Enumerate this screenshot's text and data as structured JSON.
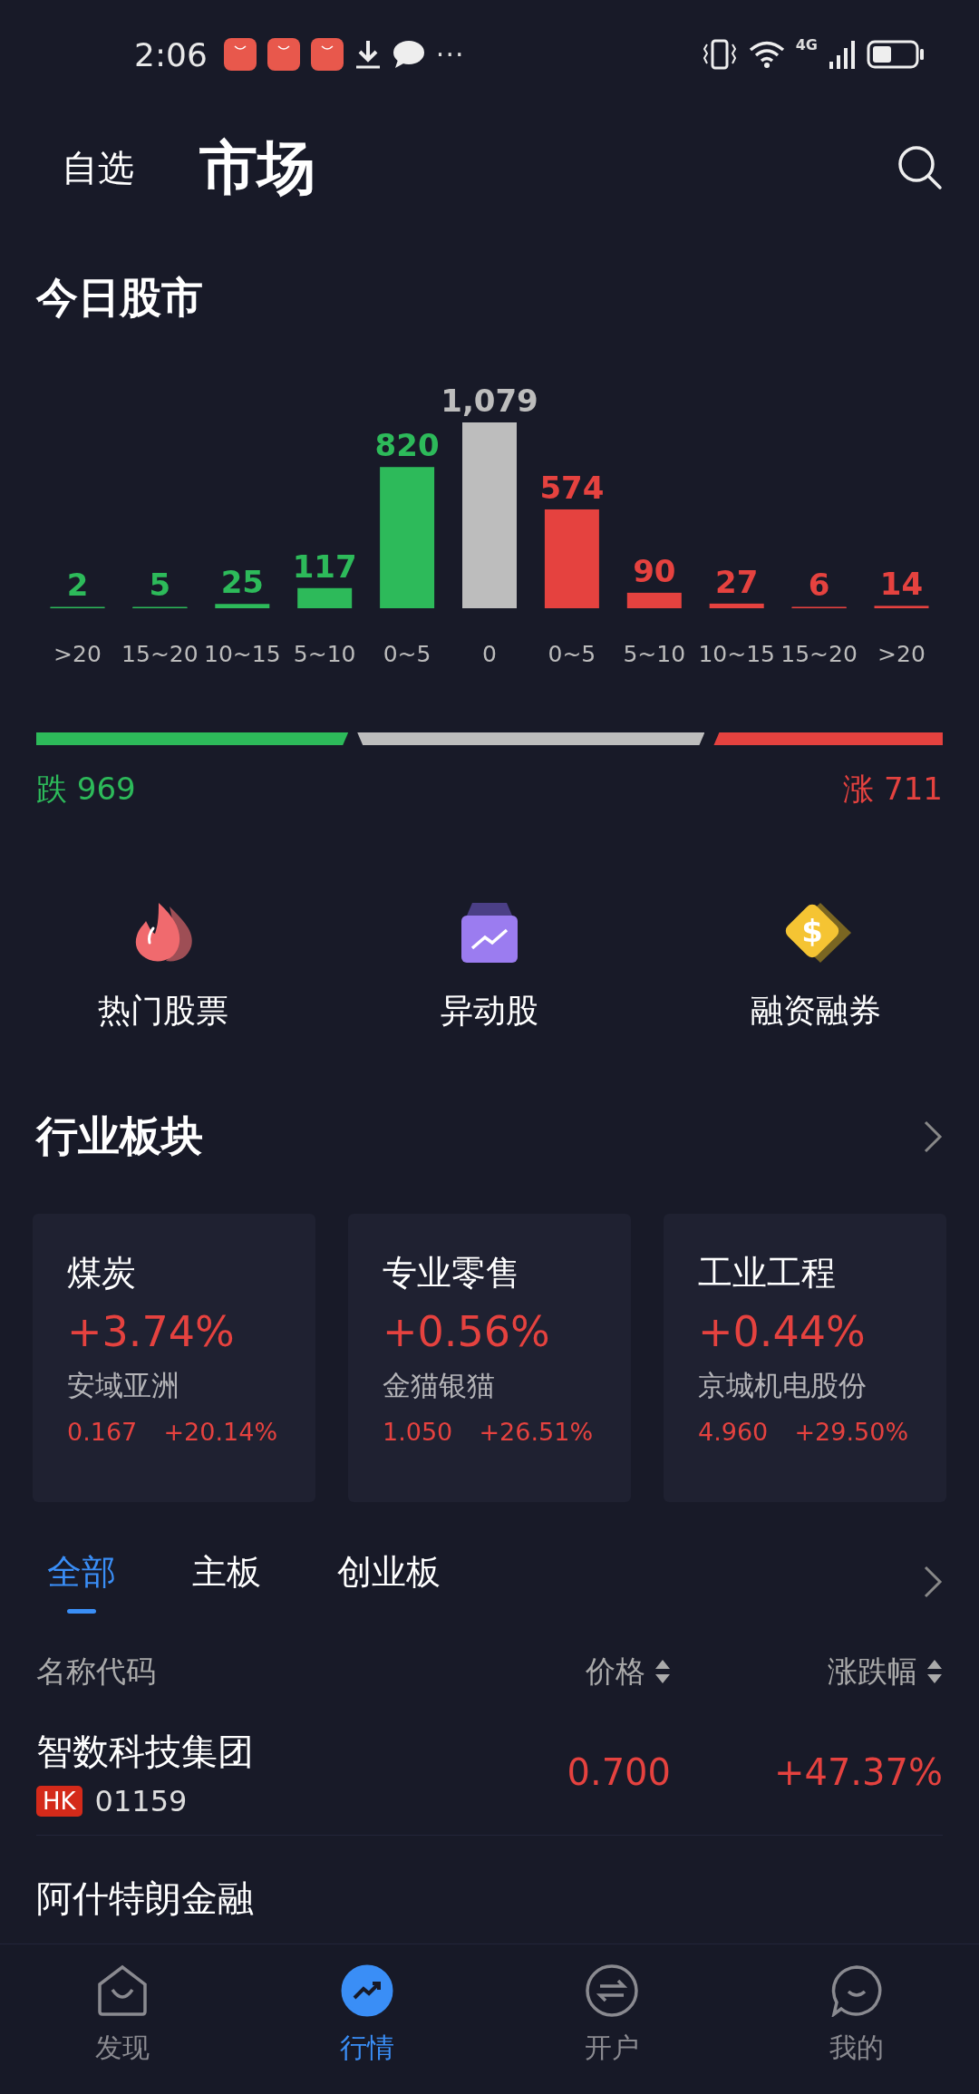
{
  "status_bar": {
    "time": "2:06",
    "more": "···",
    "network": "4G"
  },
  "header": {
    "tabs": [
      {
        "label": "自选",
        "selected": false
      },
      {
        "label": "市场",
        "selected": true
      }
    ]
  },
  "today": {
    "title": "今日股市",
    "chart_data": {
      "type": "bar",
      "categories": [
        ">20",
        "15~20",
        "10~15",
        "5~10",
        "0~5",
        "0",
        "0~5",
        "5~10",
        "10~15",
        "15~20",
        ">20"
      ],
      "series": [
        {
          "color": "#2dba5a",
          "values": [
            2,
            5,
            25,
            117,
            820,
            null,
            null,
            null,
            null,
            null,
            null
          ],
          "value_labels": [
            "2",
            "5",
            "25",
            "117",
            "820",
            null,
            null,
            null,
            null,
            null,
            null
          ]
        },
        {
          "color": "#bdbdbd",
          "values": [
            null,
            null,
            null,
            null,
            null,
            1079,
            null,
            null,
            null,
            null,
            null
          ],
          "value_labels": [
            null,
            null,
            null,
            null,
            null,
            "1,079",
            null,
            null,
            null,
            null,
            null
          ]
        },
        {
          "color": "#e5423f",
          "values": [
            null,
            null,
            null,
            null,
            null,
            null,
            574,
            90,
            27,
            6,
            14
          ],
          "value_labels": [
            null,
            null,
            null,
            null,
            null,
            null,
            "574",
            "90",
            "27",
            "6",
            "14"
          ]
        }
      ],
      "stacked": true
    },
    "down_label": "跌 969",
    "up_label": "涨 711"
  },
  "shortcuts": [
    {
      "kind": "flame",
      "label": "热门股票"
    },
    {
      "kind": "chart",
      "label": "异动股"
    },
    {
      "kind": "coin",
      "label": "融资融券",
      "glyph": "$"
    }
  ],
  "sectors": {
    "title": "行业板块",
    "cards": [
      {
        "name": "煤炭",
        "change": "+3.74%",
        "leader": "安域亚洲",
        "price": "0.167",
        "leader_change": "+20.14%"
      },
      {
        "name": "专业零售",
        "change": "+0.56%",
        "leader": "金猫银猫",
        "price": "1.050",
        "leader_change": "+26.51%"
      },
      {
        "name": "工业工程",
        "change": "+0.44%",
        "leader": "京城机电股份",
        "price": "4.960",
        "leader_change": "+29.50%"
      }
    ]
  },
  "stock_list": {
    "tabs": [
      {
        "label": "全部",
        "selected": true
      },
      {
        "label": "主板",
        "selected": false
      },
      {
        "label": "创业板",
        "selected": false
      }
    ],
    "columns": [
      "名称代码",
      "价格",
      "涨跌幅"
    ],
    "rows": [
      {
        "name": "智数科技集团",
        "market": "HK",
        "code": "01159",
        "price": "0.700",
        "change": "+47.37%"
      },
      {
        "name": "阿什特朗金融"
      }
    ]
  },
  "nav": [
    {
      "kind": "home",
      "label": "发现",
      "selected": false
    },
    {
      "kind": "trend",
      "label": "行情",
      "selected": true
    },
    {
      "kind": "swap",
      "label": "开户",
      "selected": false
    },
    {
      "kind": "chat",
      "label": "我的",
      "selected": false
    }
  ]
}
